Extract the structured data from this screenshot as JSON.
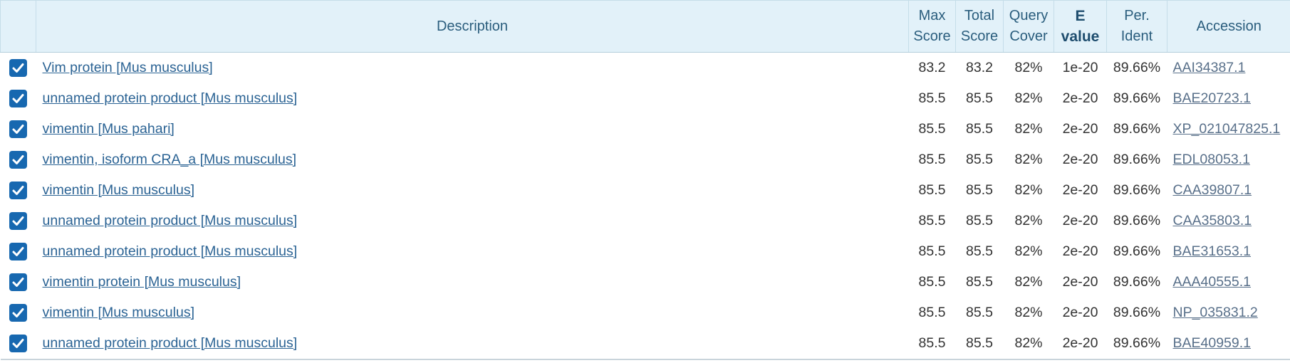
{
  "columns": {
    "description": "Description",
    "max_score": [
      "Max",
      "Score"
    ],
    "total_score": [
      "Total",
      "Score"
    ],
    "query_cover": [
      "Query",
      "Cover"
    ],
    "e_value": [
      "E",
      "value"
    ],
    "per_ident": [
      "Per.",
      "Ident"
    ],
    "accession": "Accession"
  },
  "sorted_column": "e_value",
  "colors": {
    "header_bg": "#e2f1f9",
    "header_text": "#2a5d7d",
    "link": "#2b6394",
    "checkbox": "#1768b0"
  },
  "rows": [
    {
      "checked": true,
      "description": "Vim protein [Mus musculus]",
      "max_score": "83.2",
      "total_score": "83.2",
      "query_cover": "82%",
      "e_value": "1e-20",
      "per_ident": "89.66%",
      "accession": "AAI34387.1"
    },
    {
      "checked": true,
      "description": "unnamed protein product [Mus musculus]",
      "max_score": "85.5",
      "total_score": "85.5",
      "query_cover": "82%",
      "e_value": "2e-20",
      "per_ident": "89.66%",
      "accession": "BAE20723.1"
    },
    {
      "checked": true,
      "description": "vimentin [Mus pahari]",
      "max_score": "85.5",
      "total_score": "85.5",
      "query_cover": "82%",
      "e_value": "2e-20",
      "per_ident": "89.66%",
      "accession": "XP_021047825.1"
    },
    {
      "checked": true,
      "description": "vimentin, isoform CRA_a [Mus musculus]",
      "max_score": "85.5",
      "total_score": "85.5",
      "query_cover": "82%",
      "e_value": "2e-20",
      "per_ident": "89.66%",
      "accession": "EDL08053.1"
    },
    {
      "checked": true,
      "description": "vimentin [Mus musculus]",
      "max_score": "85.5",
      "total_score": "85.5",
      "query_cover": "82%",
      "e_value": "2e-20",
      "per_ident": "89.66%",
      "accession": "CAA39807.1"
    },
    {
      "checked": true,
      "description": "unnamed protein product [Mus musculus]",
      "max_score": "85.5",
      "total_score": "85.5",
      "query_cover": "82%",
      "e_value": "2e-20",
      "per_ident": "89.66%",
      "accession": "CAA35803.1"
    },
    {
      "checked": true,
      "description": "unnamed protein product [Mus musculus]",
      "max_score": "85.5",
      "total_score": "85.5",
      "query_cover": "82%",
      "e_value": "2e-20",
      "per_ident": "89.66%",
      "accession": "BAE31653.1"
    },
    {
      "checked": true,
      "description": "vimentin protein [Mus musculus]",
      "max_score": "85.5",
      "total_score": "85.5",
      "query_cover": "82%",
      "e_value": "2e-20",
      "per_ident": "89.66%",
      "accession": "AAA40555.1"
    },
    {
      "checked": true,
      "description": "vimentin [Mus musculus]",
      "max_score": "85.5",
      "total_score": "85.5",
      "query_cover": "82%",
      "e_value": "2e-20",
      "per_ident": "89.66%",
      "accession": "NP_035831.2"
    },
    {
      "checked": true,
      "description": "unnamed protein product [Mus musculus]",
      "max_score": "85.5",
      "total_score": "85.5",
      "query_cover": "82%",
      "e_value": "2e-20",
      "per_ident": "89.66%",
      "accession": "BAE40959.1"
    }
  ]
}
